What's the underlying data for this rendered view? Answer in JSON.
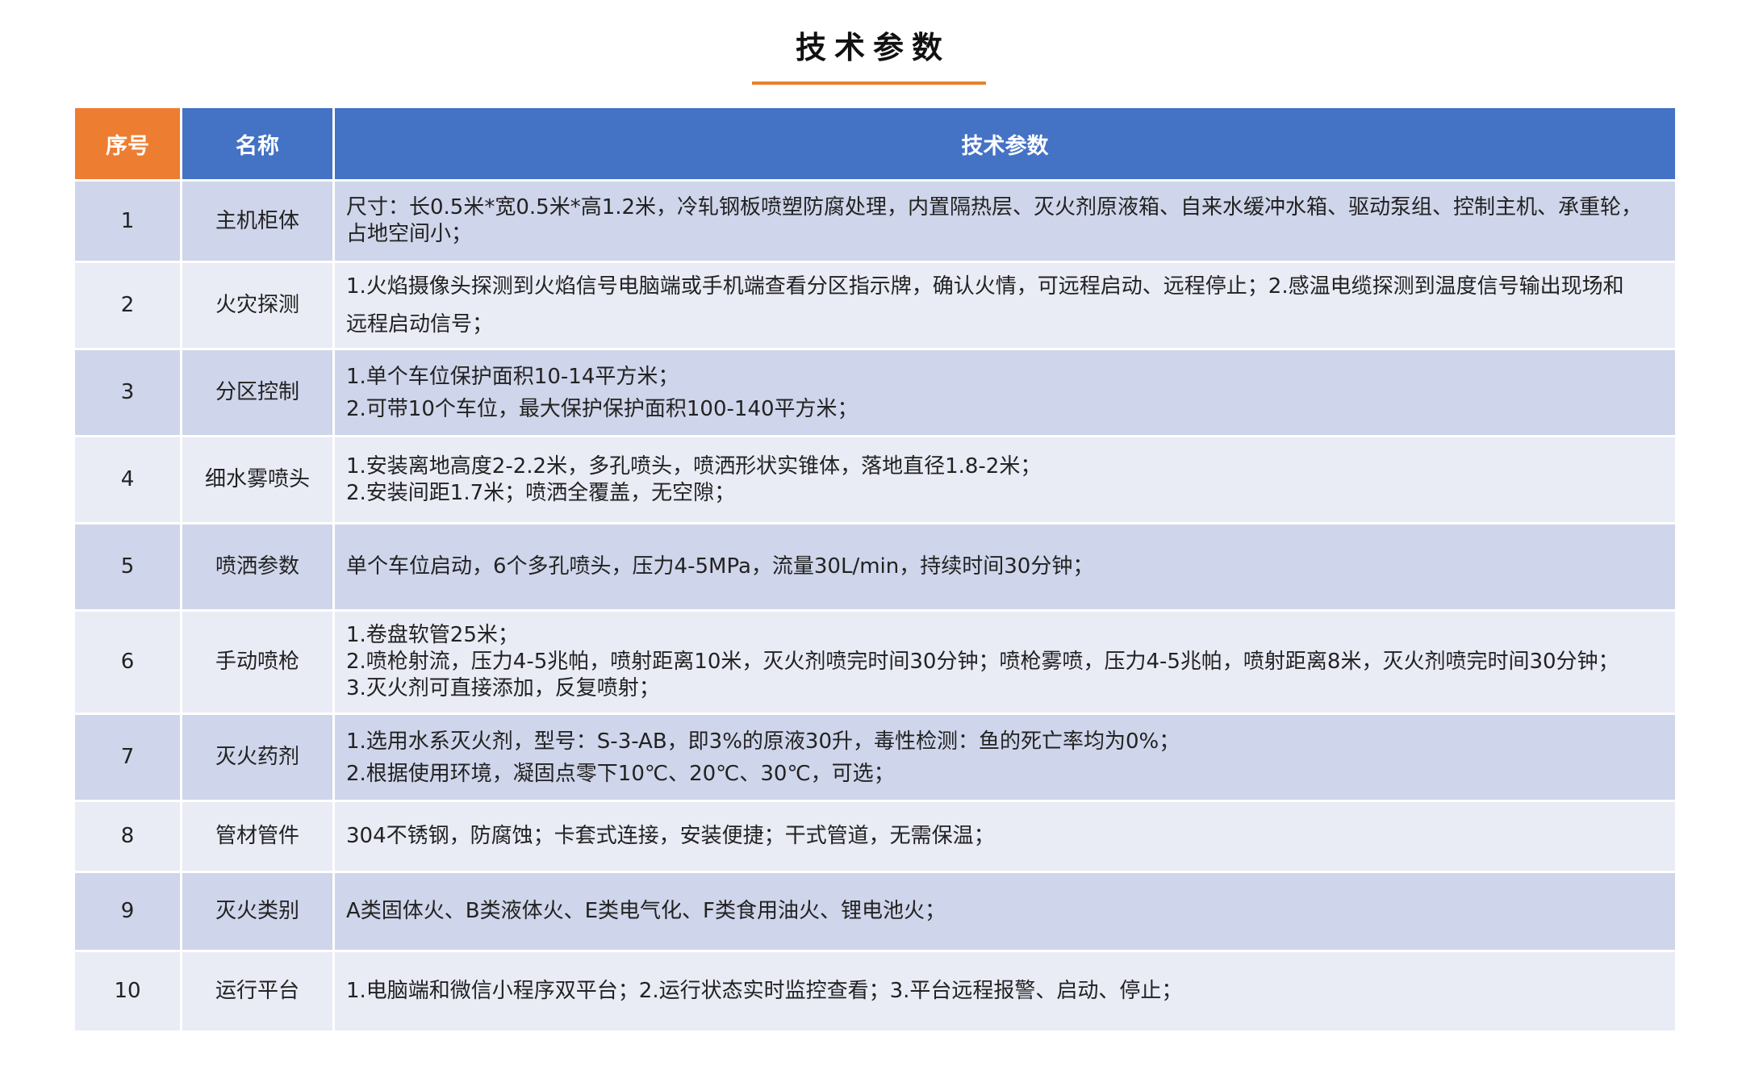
{
  "title": "技术参数",
  "colors": {
    "header_index_bg": "#ed7d31",
    "header_bg": "#4472c4",
    "row_odd_bg": "#cfd5ea",
    "row_even_bg": "#e9ebf5",
    "title_underline": "#e8822d"
  },
  "table": {
    "headers": [
      "序号",
      "名称",
      "技术参数"
    ],
    "rows": [
      {
        "index": "1",
        "name": "主机柜体",
        "lines": [
          "尺寸：长0.5米*宽0.5米*高1.2米，冷轧钢板喷塑防腐处理，内置隔热层、灭火剂原液箱、自来水缓冲水箱、驱动泵组、控制主机、承重轮，",
          "占地空间小；"
        ]
      },
      {
        "index": "2",
        "name": "火灾探测",
        "lines": [
          "1.火焰摄像头探测到火焰信号电脑端或手机端查看分区指示牌，确认火情，可远程启动、远程停止；2.感温电缆探测到温度信号输出现场和",
          "远程启动信号；"
        ]
      },
      {
        "index": "3",
        "name": "分区控制",
        "lines": [
          "1.单个车位保护面积10-14平方米；",
          "2.可带10个车位，最大保护保护面积100-140平方米；"
        ]
      },
      {
        "index": "4",
        "name": "细水雾喷头",
        "lines": [
          "1.安装离地高度2-2.2米，多孔喷头，喷洒形状实锥体，落地直径1.8-2米；",
          "2.安装间距1.7米；喷洒全覆盖，无空隙；"
        ]
      },
      {
        "index": "5",
        "name": "喷洒参数",
        "lines": [
          "单个车位启动，6个多孔喷头，压力4-5MPa，流量30L/min，持续时间30分钟；"
        ]
      },
      {
        "index": "6",
        "name": "手动喷枪",
        "lines": [
          "1.卷盘软管25米；",
          "2.喷枪射流，压力4-5兆帕，喷射距离10米，灭火剂喷完时间30分钟；喷枪雾喷，压力4-5兆帕，喷射距离8米，灭火剂喷完时间30分钟；",
          "3.灭火剂可直接添加，反复喷射；"
        ]
      },
      {
        "index": "7",
        "name": "灭火药剂",
        "lines": [
          "1.选用水系灭火剂，型号：S-3-AB，即3%的原液30升，毒性检测：鱼的死亡率均为0%；",
          "2.根据使用环境，凝固点零下10℃、20℃、30℃，可选；"
        ]
      },
      {
        "index": "8",
        "name": "管材管件",
        "lines": [
          "304不锈钢，防腐蚀；卡套式连接，安装便捷；干式管道，无需保温；"
        ]
      },
      {
        "index": "9",
        "name": "灭火类别",
        "lines": [
          "A类固体火、B类液体火、E类电气化、F类食用油火、锂电池火；"
        ]
      },
      {
        "index": "10",
        "name": "运行平台",
        "lines": [
          "1.电脑端和微信小程序双平台；2.运行状态实时监控查看；3.平台远程报警、启动、停止；"
        ]
      }
    ]
  }
}
